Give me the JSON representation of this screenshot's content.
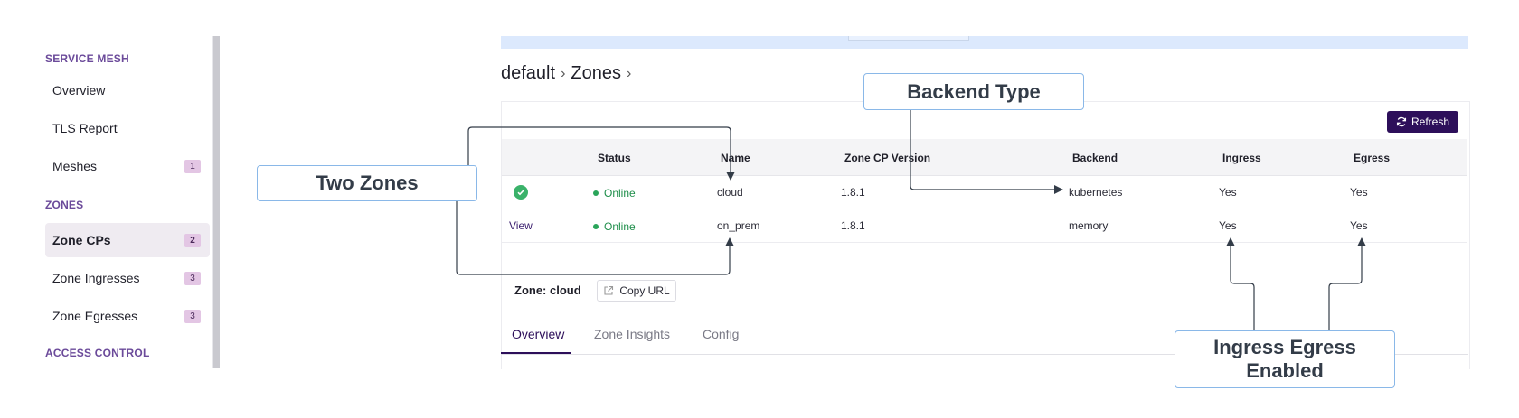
{
  "sidebar": {
    "sections": {
      "service_mesh": "SERVICE MESH",
      "zones": "ZONES",
      "access_control": "ACCESS CONTROL"
    },
    "items": [
      {
        "label": "Overview"
      },
      {
        "label": "TLS Report"
      },
      {
        "label": "Meshes",
        "count": "1"
      },
      {
        "label": "Zone CPs",
        "count": "2"
      },
      {
        "label": "Zone Ingresses",
        "count": "3"
      },
      {
        "label": "Zone Egresses",
        "count": "3"
      }
    ]
  },
  "breadcrumb": {
    "items": [
      "default",
      "Zones"
    ],
    "separator": "›"
  },
  "toolbar": {
    "refresh_label": "Refresh"
  },
  "table": {
    "headers": [
      "Status",
      "Name",
      "Zone CP Version",
      "Backend",
      "Ingress",
      "Egress"
    ],
    "rows": [
      {
        "action": "",
        "status": "Online",
        "name": "cloud",
        "version": "1.8.1",
        "backend": "kubernetes",
        "ingress": "Yes",
        "egress": "Yes"
      },
      {
        "action": "View",
        "status": "Online",
        "name": "on_prem",
        "version": "1.8.1",
        "backend": "memory",
        "ingress": "Yes",
        "egress": "Yes"
      }
    ]
  },
  "detail": {
    "zone_title": "Zone: cloud",
    "copy_url_label": "Copy URL",
    "tabs": [
      "Overview",
      "Zone Insights",
      "Config"
    ]
  },
  "callouts": {
    "backend_type": "Backend Type",
    "two_zones": "Two Zones",
    "ingress_egress": "Ingress Egress Enabled"
  },
  "colors": {
    "accent": "#2d0f5a",
    "online": "#2aa55a",
    "callout_border": "#8ab8e8"
  }
}
